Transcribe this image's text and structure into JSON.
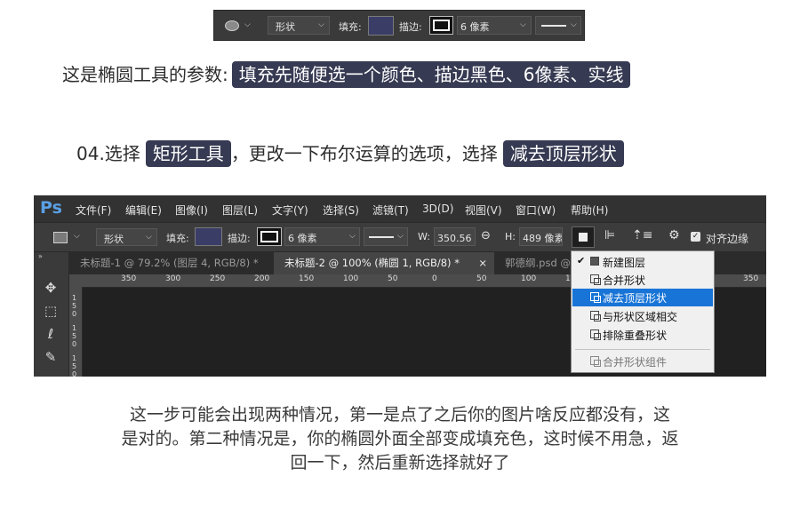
{
  "topbar": {
    "shape_mode": "形状",
    "fill_label": "填充:",
    "stroke_label": "描边:",
    "stroke_size": "6 像素"
  },
  "caption1": {
    "prefix": "这是椭圆工具的参数:",
    "highlight": "填充先随便选一个颜色、描边黑色、6像素、实线"
  },
  "caption2": {
    "prefix": "04.选择",
    "highlight1": "矩形工具",
    "middle": "，更改一下布尔运算的选项，选择",
    "highlight2": "减去顶层形状"
  },
  "ps": {
    "logo": "Ps",
    "menu": [
      "文件(F)",
      "编辑(E)",
      "图像(I)",
      "图层(L)",
      "文字(Y)",
      "选择(S)",
      "滤镜(T)",
      "3D(D)",
      "视图(V)",
      "窗口(W)",
      "帮助(H)"
    ],
    "options": {
      "shape_mode": "形状",
      "fill_label": "填充:",
      "stroke_label": "描边:",
      "stroke_size": "6 像素",
      "w_label": "W:",
      "w_value": "350.56 像",
      "link_icon": "link-icon",
      "h_label": "H:",
      "h_value": "489 像素",
      "align_edges_label": "对齐边缘"
    },
    "tabs": [
      "未标题-1 @ 79.2% (图层 4, RGB/8) *",
      "未标题-2 @ 100% (椭圆 1, RGB/8) *",
      "郭德纲.psd @ 1"
    ],
    "ruler_h": [
      "350",
      "300",
      "250",
      "200",
      "150",
      "100",
      "50",
      "0",
      "50",
      "100",
      "150",
      "350"
    ],
    "ruler_v": [
      "1",
      "5",
      "0",
      "1",
      "5",
      "0",
      "1",
      "5",
      "0"
    ],
    "dropdown": {
      "items": [
        "新建图层",
        "合并形状",
        "减去顶层形状",
        "与形状区域相交",
        "排除重叠形状"
      ],
      "selected_index": 2,
      "merge_components": "合并形状组件"
    }
  },
  "paragraph": {
    "line1": "这一步可能会出现两种情况，第一是点了之后你的图片啥反应都没有，这",
    "line2": "是对的。第二种情况是，你的椭圆外面全部变成填充色，这时候不用急，返",
    "line3": "回一下，然后重新选择就好了"
  },
  "colors": {
    "highlight_bg": "#363a52",
    "fill_swatch": "#3a3d66",
    "selection_blue": "#1874d6"
  }
}
